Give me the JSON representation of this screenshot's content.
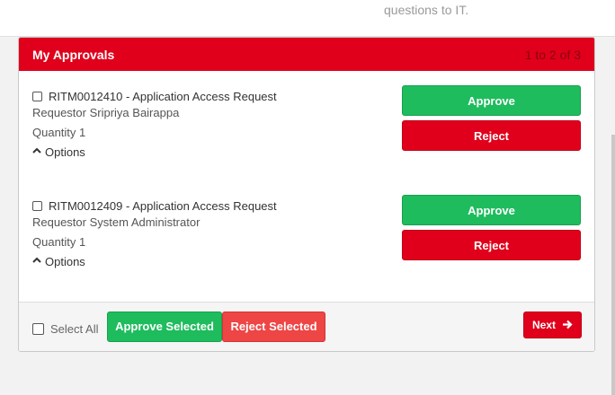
{
  "top": {
    "text": "questions to IT."
  },
  "panel": {
    "title": "My Approvals",
    "count": "1 to 2 of 3"
  },
  "items": [
    {
      "title": "RITM0012410 - Application Access Request",
      "requestor": "Requestor Sripriya Bairappa",
      "quantity": "Quantity 1",
      "options": "Options",
      "approve": "Approve",
      "reject": "Reject"
    },
    {
      "title": "RITM0012409 - Application Access Request",
      "requestor": "Requestor System Administrator",
      "quantity": "Quantity 1",
      "options": "Options",
      "approve": "Approve",
      "reject": "Reject"
    }
  ],
  "footer": {
    "select_all": "Select All",
    "approve_selected": "Approve Selected",
    "reject_selected": "Reject Selected",
    "next": "Next"
  },
  "colors": {
    "header": "#e0001b",
    "approve": "#1ebc5d",
    "reject": "#e0001b",
    "reject_selected": "#ee4545"
  },
  "icons": {
    "options": "chevron-up-icon",
    "next": "arrow-right-icon"
  }
}
